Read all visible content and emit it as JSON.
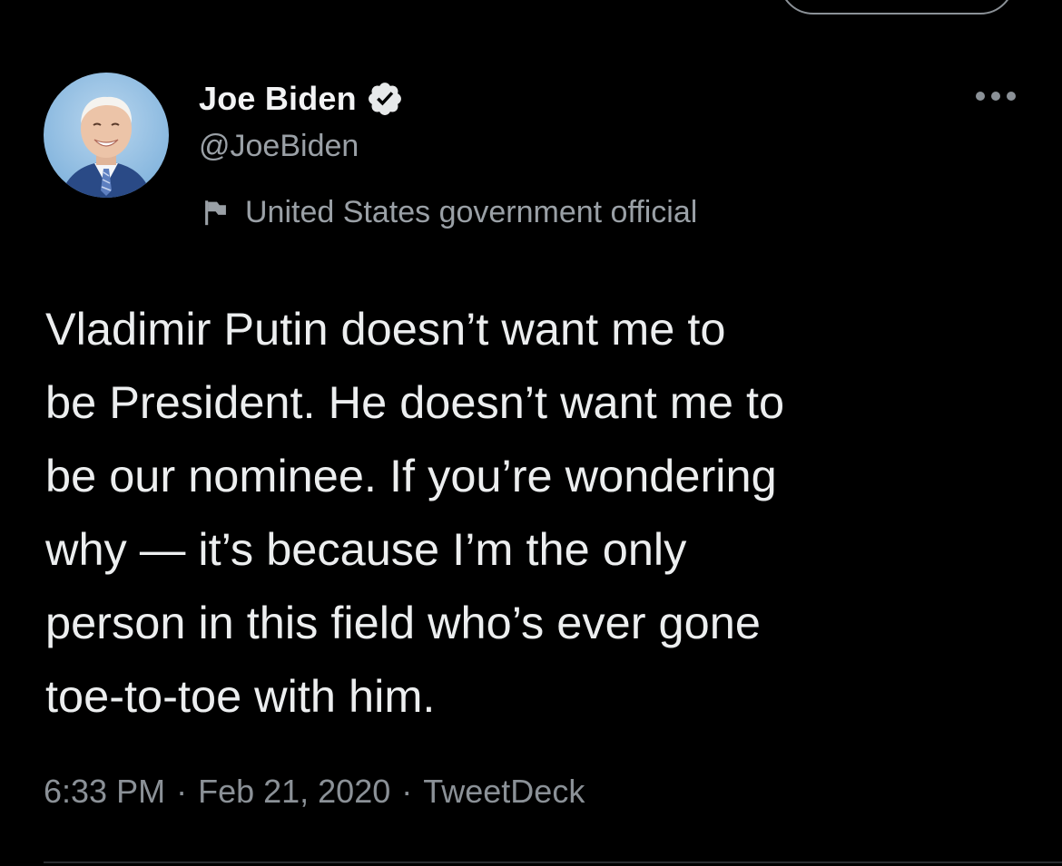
{
  "tweet": {
    "display_name": "Joe Biden",
    "handle": "@JoeBiden",
    "account_label": "United States government official",
    "text": "Vladimir Putin doesn’t want me to\nbe President. He doesn’t want me to\nbe our nominee. If you’re wondering\nwhy — it’s because I’m the only\nperson in this field who’s ever gone\ntoe-to-toe with him.",
    "time": "6:33 PM",
    "date": "Feb 21, 2020",
    "source": "TweetDeck",
    "separator": "·"
  },
  "icons": {
    "verified": "verified-badge-icon",
    "label": "flag-icon",
    "more": "more-horizontal-icon",
    "avatar": "profile-photo"
  },
  "colors": {
    "background": "#000000",
    "primary_text": "#e7e9ea",
    "secondary_text": "#8b9197",
    "verified_badge": "#e7e9ea"
  }
}
